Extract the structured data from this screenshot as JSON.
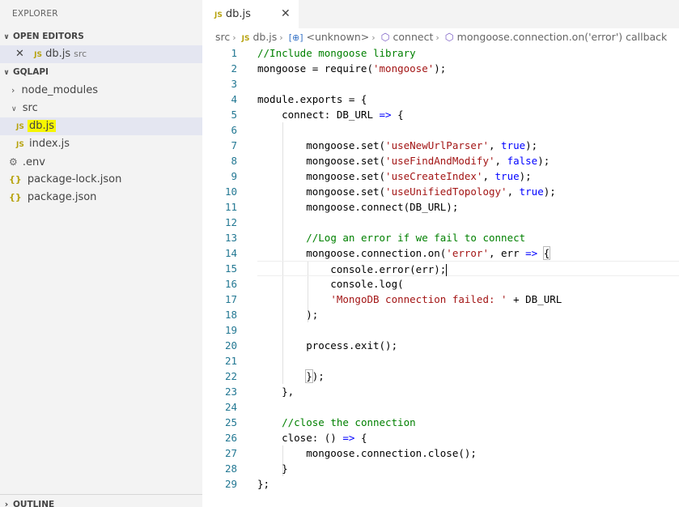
{
  "explorer": {
    "title": "EXPLORER",
    "open_editors_label": "OPEN EDITORS",
    "open_editor": {
      "name": "db.js",
      "desc": "src"
    },
    "project_label": "GQLAPI",
    "tree": [
      {
        "kind": "folder",
        "name": "node_modules"
      },
      {
        "kind": "folder",
        "name": "src"
      },
      {
        "kind": "js",
        "name": "db.js"
      },
      {
        "kind": "js",
        "name": "index.js"
      },
      {
        "kind": "env",
        "name": ".env"
      },
      {
        "kind": "json",
        "name": "package-lock.json"
      },
      {
        "kind": "json",
        "name": "package.json"
      }
    ],
    "outline_label": "OUTLINE"
  },
  "tab": {
    "label": "db.js",
    "badge": "JS"
  },
  "breadcrumb": [
    "src",
    "db.js",
    "<unknown>",
    "connect",
    "mongoose.connection.on('error') callback"
  ],
  "lines": [
    "1",
    "2",
    "3",
    "4",
    "5",
    "6",
    "7",
    "8",
    "9",
    "10",
    "11",
    "12",
    "13",
    "14",
    "15",
    "16",
    "17",
    "18",
    "19",
    "20",
    "21",
    "22",
    "23",
    "24",
    "25",
    "26",
    "27",
    "28",
    "29"
  ],
  "icons": {
    "file_js": "js-icon",
    "folder_closed": "chevron-right-icon",
    "folder_open": "chevron-down-icon",
    "env": "gear-icon",
    "json": "braces-icon"
  },
  "colors": {
    "comment": "#008000",
    "string": "#a31515",
    "keyword": "#0000ff",
    "line_number": "#237893"
  }
}
